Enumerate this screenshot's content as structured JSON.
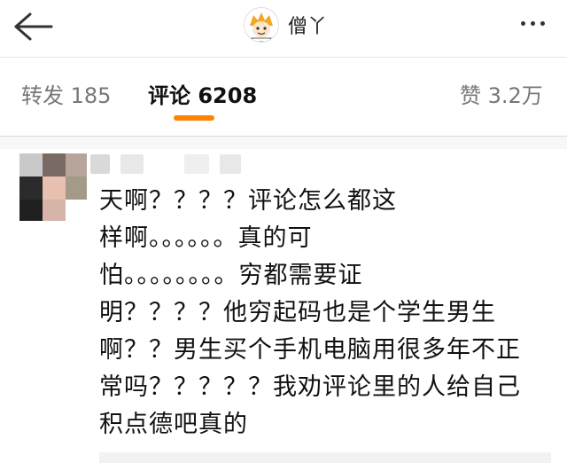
{
  "header": {
    "back_icon": "back-arrow-icon",
    "title": "僧丫",
    "more_icon": "more-dots-icon"
  },
  "tabs": [
    {
      "label": "转发 185",
      "active": false
    },
    {
      "label": "评论 6208",
      "active": true
    },
    {
      "label": "赞 3.2万",
      "active": false
    }
  ],
  "colors": {
    "accent": "#ff8200",
    "text": "#111111",
    "muted": "#777777"
  },
  "comment": {
    "text": "天啊？？？？评论怎么都这\n样啊。。。。。。真的可\n怕。。。。。。。。穷都需要证\n明？？？？他穷起码也是个学生男生\n啊？？男生买个手机电脑用很多年不正\n常吗？？？？？我劝评论里的人给自己\n积点德吧真的"
  }
}
